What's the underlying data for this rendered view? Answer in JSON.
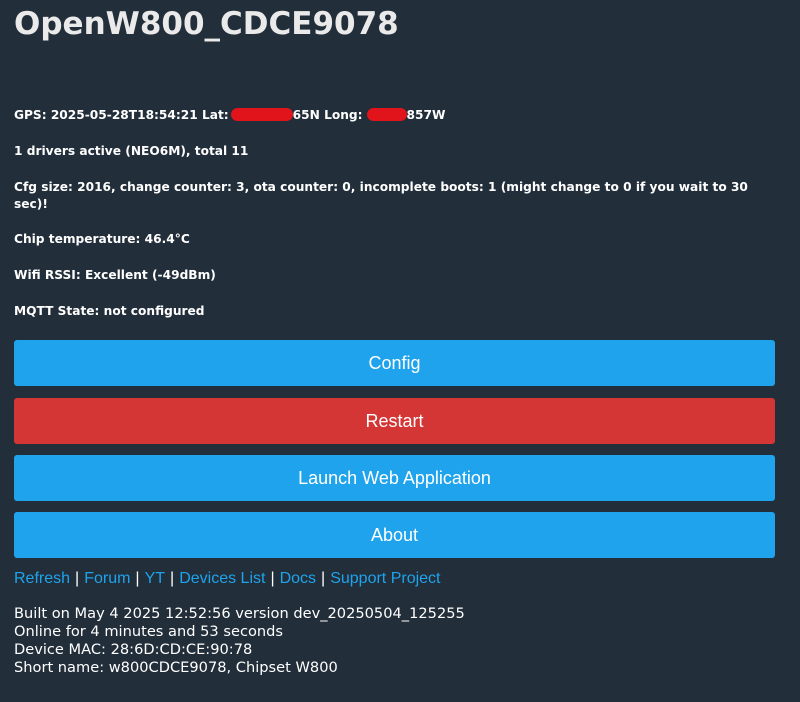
{
  "page": {
    "title": "OpenW800_CDCE9078"
  },
  "status": {
    "gps_prefix": "GPS: 2025-05-28T18:54:21 Lat:",
    "gps_lat_suffix": "65N Long:",
    "gps_long_suffix": "857W",
    "drivers": "1 drivers active (NEO6M), total 11",
    "cfg": "Cfg size: 2016, change counter: 3, ota counter: 0, incomplete boots: 1 (might change to 0 if you wait to 30 sec)!",
    "chip_temp": "Chip temperature: 46.4°C",
    "wifi": "Wifi RSSI: Excellent (-49dBm)",
    "mqtt": "MQTT State: not configured"
  },
  "buttons": {
    "config": "Config",
    "restart": "Restart",
    "launch_web_app": "Launch Web Application",
    "about": "About"
  },
  "links": [
    "Refresh",
    "Forum",
    "YT",
    "Devices List",
    "Docs",
    "Support Project"
  ],
  "footer": {
    "built": "Built on May 4 2025 12:52:56 version dev_20250504_125255",
    "online": "Online for 4 minutes and 53 seconds",
    "mac": "Device MAC: 28:6D:CD:CE:90:78",
    "short_name": "Short name: w800CDCE9078, Chipset W800"
  },
  "colors": {
    "background": "#222e3a",
    "button_blue": "#1fa3ec",
    "button_red": "#d43535",
    "link": "#1fa3ec",
    "redaction": "#e0141a"
  }
}
